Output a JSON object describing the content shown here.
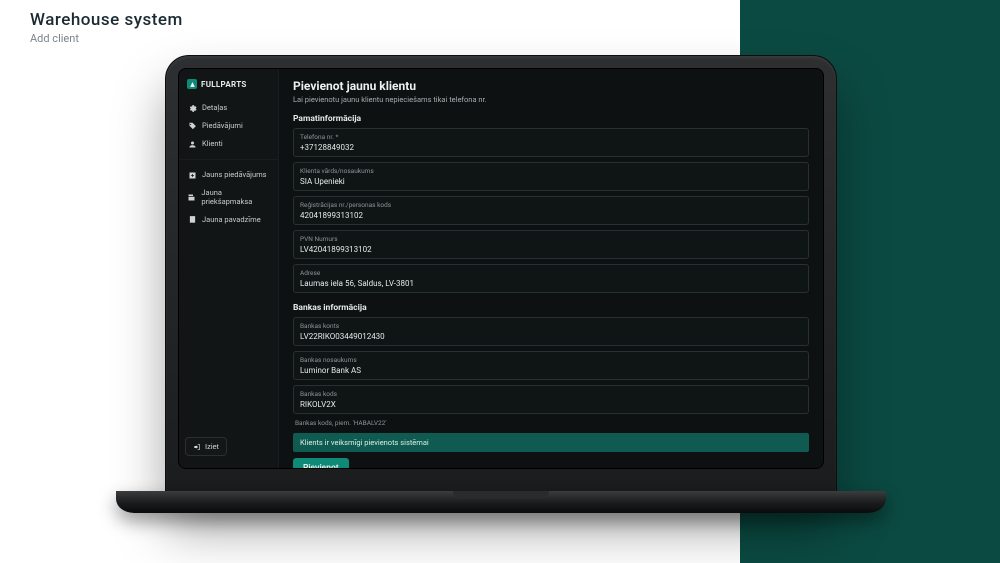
{
  "caption": {
    "title": "Warehouse system",
    "subtitle": "Add client"
  },
  "brand": {
    "name": "FULLPARTS"
  },
  "sidebar": {
    "primary": [
      {
        "icon": "gear-icon",
        "label": "Detaļas"
      },
      {
        "icon": "tag-icon",
        "label": "Piedāvājumi"
      },
      {
        "icon": "person-icon",
        "label": "Klienti"
      }
    ],
    "secondary": [
      {
        "icon": "plus-box-icon",
        "label": "Jauns piedāvājums"
      },
      {
        "icon": "prepay-icon",
        "label": "Jauna priekšapmaksa"
      },
      {
        "icon": "receipt-icon",
        "label": "Jauna pavadzīme"
      }
    ],
    "logout": "Iziet"
  },
  "page": {
    "title": "Pievienot jaunu klientu",
    "subtitle": "Lai pievienotu jaunu klientu nepieciešams tikai telefona nr."
  },
  "sections": {
    "basic": {
      "title": "Pamatinformācija",
      "phone": {
        "label": "Telefona nr. *",
        "value": "+37128849032"
      },
      "name": {
        "label": "Klienta vārds/nosaukums",
        "value": "SIA Upenieki"
      },
      "regno": {
        "label": "Reģistrācijas nr./personas kods",
        "value": "42041899313102"
      },
      "vat": {
        "label": "PVN Numurs",
        "value": "LV42041899313102"
      },
      "address": {
        "label": "Adrese",
        "value": "Laumas iela 56, Saldus, LV-3801"
      }
    },
    "bank": {
      "title": "Bankas informācija",
      "account": {
        "label": "Bankas konts",
        "value": "LV22RIKO03449012430"
      },
      "bankname": {
        "label": "Bankas nosaukums",
        "value": "Luminor Bank AS"
      },
      "code": {
        "label": "Bankas kods",
        "value": "RIKOLV2X"
      },
      "hint": "Bankas kods, piem. 'HABALV22'"
    }
  },
  "alert": {
    "text": "Klients ir veiksmīgi pievienots sistēmai"
  },
  "actions": {
    "submit": "Pievienot"
  }
}
